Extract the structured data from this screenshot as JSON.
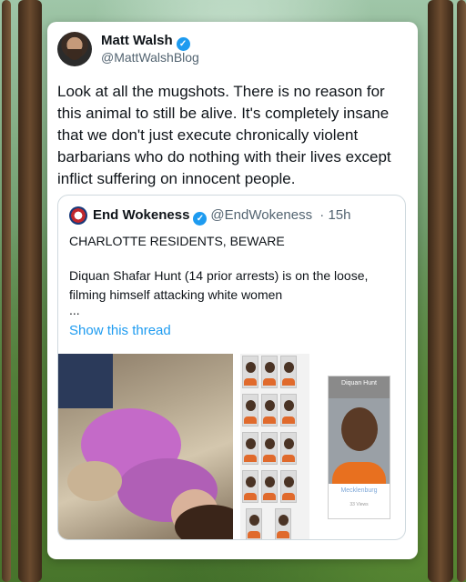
{
  "tweet": {
    "author_name": "Matt Walsh",
    "author_handle": "@MattWalshBlog",
    "verified_glyph": "✓",
    "text": "Look at all the mugshots. There is no reason for this animal to still be alive. It's completely insane that we don't just execute chronically violent barbarians who do nothing with their lives except inflict suffering on innocent people."
  },
  "quoted": {
    "author_name": "End Wokeness",
    "author_handle": "@EndWokeness",
    "time": "· 15h",
    "line1": "CHARLOTTE RESIDENTS, BEWARE",
    "body": "Diquan Shafar Hunt (14 prior arrests) is on the loose, filming himself attacking white women",
    "ellipsis": "...",
    "show_thread": "Show this thread"
  },
  "mugshot_card": {
    "name": "Diquan Hunt",
    "county": "Mecklenburg",
    "views": "33 Views"
  },
  "colors": {
    "accent": "#1d9bf0",
    "text": "#0f1419",
    "muted": "#536471"
  }
}
